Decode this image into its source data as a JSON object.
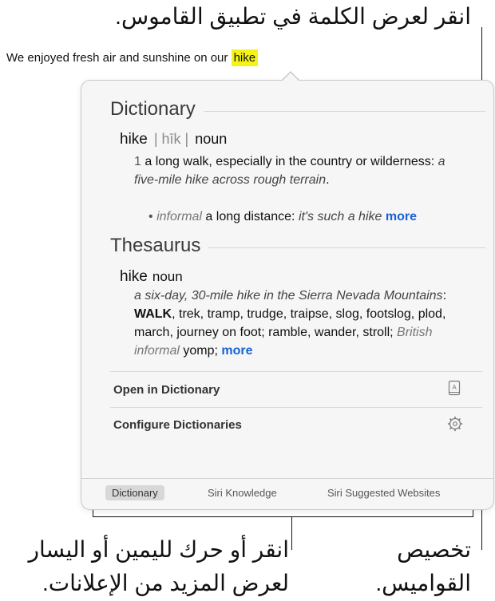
{
  "callouts": {
    "top": "انقر لعرض الكلمة في تطبيق القاموس.",
    "left_line1": "انقر أو حرك لليمين أو اليسار",
    "left_line2": "لعرض المزيد من الإعلانات.",
    "right_line1": "تخصيص",
    "right_line2": "القواميس."
  },
  "sentence": {
    "text": "We enjoyed fresh air and sunshine on our ",
    "highlight": "hike"
  },
  "dictionary": {
    "title": "Dictionary",
    "word": "hike",
    "pronunciation": "| hīk |",
    "pos": "noun",
    "def1_num": "1",
    "def1_text": "a long walk, especially in the country or wilderness:",
    "def1_example": "a five-mile hike across rough terrain",
    "def1_end": ".",
    "bullet": "•",
    "sub_label": "informal",
    "sub_text": "a long distance:",
    "sub_example": "it's such a hike",
    "more": "more"
  },
  "thesaurus": {
    "title": "Thesaurus",
    "word": "hike",
    "pos": "noun",
    "example": "a six-day, 30-mile hike in the Sierra Nevada Mountains",
    "colon": ":",
    "synonyms_bold": "WALK",
    "synonyms": ", trek, tramp, trudge, traipse, slog, footslog, plod, march, journey on foot; ramble, wander, stroll; ",
    "regional": "British informal",
    "regional_word": " yomp;",
    "more": "more"
  },
  "actions": {
    "open": "Open in Dictionary",
    "configure": "Configure Dictionaries"
  },
  "tabs": [
    "Dictionary",
    "Siri Knowledge",
    "Siri Suggested Websites"
  ],
  "icons": {
    "open": "dictionary-book-icon",
    "configure": "gear-icon"
  }
}
